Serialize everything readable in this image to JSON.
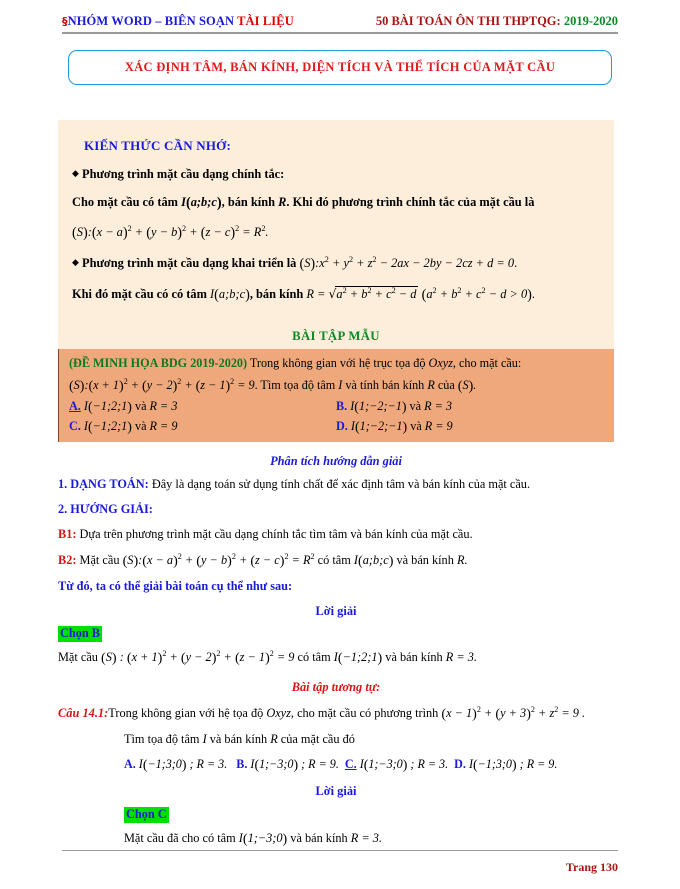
{
  "header": {
    "mark_icon": "section-mark-icon",
    "left_part1": "NHÓM WORD",
    "left_dash": " – ",
    "left_part2": "BIÊN SOẠN",
    "left_part3": " TÀI LIỆU",
    "right_part1": "50 BÀI TOÁN ÔN THI THPTQG:",
    "right_part2": " 2019-2020"
  },
  "title": {
    "text": "XÁC ĐỊNH TÂM, BÁN KÍNH, DIỆN TÍCH VÀ THỂ TÍCH CỦA MẶT CẦU"
  },
  "knowledge": {
    "heading": "KIẾN THỨC CẦN NHỚ:",
    "b1_label": "Phương trình mặt cầu dạng chính tắc:",
    "b1_text_a": "Cho mặt cầu có tâm",
    "b1_center": "I(a;b;c)",
    "b1_text_b": ", bán kính",
    "b1_R": "R",
    "b1_text_c": ". Khi đó phương trình chính tắc của mặt cầu là",
    "eq_canonical": "(S):(x−a)² + (y−b)² + (z−c)² = R².",
    "b2_label": "Phương trình mặt cầu dạng khai triển là",
    "eq_expanded": "(S):x² + y² + z² − 2ax − 2by − 2cz + d = 0.",
    "b3_text_a": "Khi đó mặt cầu có có tâm",
    "b3_center": "I(a;b;c)",
    "b3_text_b": ", bán kính",
    "b3_radius": "R = √(a² + b² + c² − d)",
    "b3_cond": "(a² + b² + c² − d > 0)."
  },
  "sample": {
    "heading": "BÀI TẬP MẪU",
    "source_tag": "(ĐỀ MINH HỌA BDG 2019-2020)",
    "prompt_a": "Trong không gian với hệ trục tọa độ",
    "prompt_axes": "Oxyz",
    "prompt_b": ", cho mặt cầu:",
    "equation": "(S):(x+1)² + (y−2)² + (z−1)² = 9",
    "prompt_c": ". Tìm tọa độ tâm",
    "prompt_I": "I",
    "prompt_d": "và tính bán kính",
    "prompt_R": "R",
    "prompt_e": "của",
    "prompt_S": "(S).",
    "options": [
      {
        "key": "A.",
        "selected": true,
        "text": "I(−1;2;1) và R = 3"
      },
      {
        "key": "B.",
        "selected": false,
        "text": "I(1;−2;−1) và R = 3"
      },
      {
        "key": "C.",
        "selected": false,
        "text": "I(−1;2;1) và R = 9"
      },
      {
        "key": "D.",
        "selected": false,
        "text": "I(1;−2;−1) và R = 9"
      }
    ]
  },
  "analysis": {
    "heading": "Phân tích hướng dẫn giải",
    "item1_label": "1. DẠNG TOÁN:",
    "item1_text": "Đây là dạng toán sử dụng tính chất để xác định tâm và bán kính của mặt cầu.",
    "item2_label": "2. HƯỚNG GIẢI:",
    "b1_label": "B1:",
    "b1_text": "Dựa trên phương trình mặt cầu dạng chính tắc tìm tâm và bán kính của mặt cầu.",
    "b2_label": "B2:",
    "b2_text_a": "Mặt cầu",
    "b2_eq": "(S):(x−a)² + (y−b)² + (z−c)² = R²",
    "b2_text_b": "có tâm",
    "b2_center": "I(a;b;c)",
    "b2_text_c": "và bán kính",
    "b2_R": "R.",
    "conclusion": "Từ đó, ta có thể giải bài toán cụ thể như sau:"
  },
  "solution": {
    "heading": "Lời giải",
    "choice_label": "Chọn B",
    "text_a": "Mặt cầu",
    "equation": "(S):(x+1)² + (y−2)² + (z−1)² = 9",
    "text_b": "có tâm",
    "center": "I(−1;2;1)",
    "text_c": "và bán kính",
    "radius": "R = 3."
  },
  "similar": {
    "heading": "Bài tập tương tự:",
    "question_label": "Câu 14.1:",
    "question_a": "Trong không gian với hệ tọa độ",
    "question_axes": "Oxyz",
    "question_b": ", cho mặt cầu có phương trình",
    "question_eq": "(x−1)² + (y+3)² + z² = 9 .",
    "question_c": "Tìm tọa độ tâm",
    "question_I": "I",
    "question_d": "và bán kính",
    "question_R": "R",
    "question_e": "của mặt cầu đó",
    "options": [
      {
        "key": "A.",
        "selected": false,
        "text": "I(−1;3;0) ;  R = 3."
      },
      {
        "key": "B.",
        "selected": false,
        "text": "I(1;−3;0) ;  R = 9."
      },
      {
        "key": "C.",
        "selected": true,
        "text": "I(1;−3;0) ;  R = 3."
      },
      {
        "key": "D.",
        "selected": false,
        "text": "I(−1;3;0) ;  R = 9."
      }
    ],
    "solution_heading": "Lời giải",
    "choice_label": "Chọn C",
    "solution_a": "Mặt cầu đã cho có tâm",
    "solution_center": "I(1;−3;0)",
    "solution_b": "và bán kính",
    "solution_radius": "R = 3."
  },
  "footer": {
    "page_label": "Trang 130"
  },
  "colors": {
    "title_red": "#e01a1a",
    "title_border_blue": "#1f9bdd",
    "blue": "#1a1ad8",
    "green": "#0f8a28",
    "dark_red": "#a81414",
    "cream_bg": "#fdeedb",
    "orange_bg": "#efa87c",
    "highlight_green": "#00e000"
  }
}
